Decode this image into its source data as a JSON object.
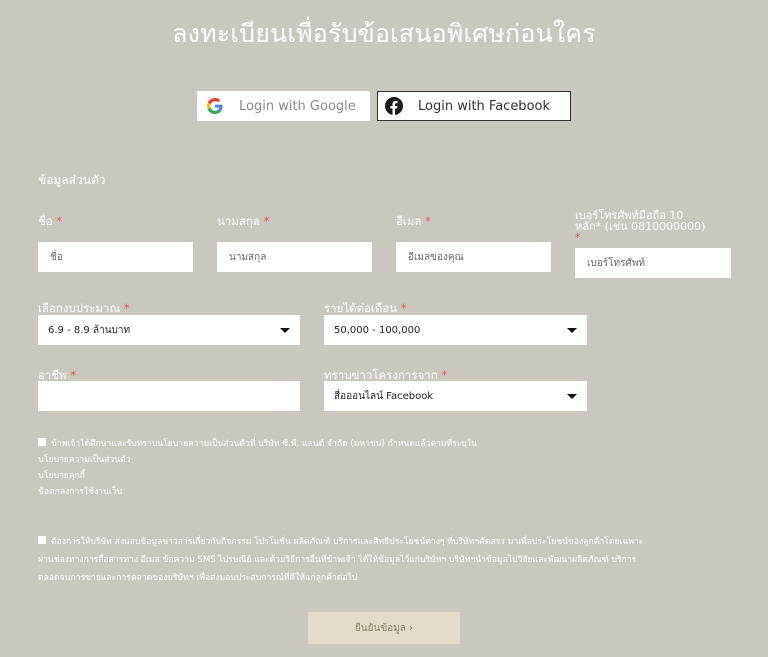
{
  "header": {
    "title": "ลงทะเบียนเพื่อรับข้อเสนอพิเศษก่อนใคร"
  },
  "social": {
    "google_label": "Login with Google",
    "facebook_label": "Login with Facebook"
  },
  "form": {
    "section_title": "ข้อมูลส่วนตัว",
    "required_mark": "*",
    "first_name": {
      "label": "ชื่อ",
      "placeholder": "ชื่อ"
    },
    "last_name": {
      "label": "นามสกุล",
      "placeholder": "นามสกุล"
    },
    "email": {
      "label": "อีเมล",
      "placeholder": "อีเมลของคุณ"
    },
    "phone": {
      "label_line1": "เบอร์โทรศัพท์มือถือ 10",
      "label_line2": "หลัก* (เช่น 0810000000)",
      "placeholder": "เบอร์โทรศัพท์"
    },
    "budget": {
      "label": "เลือกงบประมาณ",
      "value": "6.9 - 8.9 ล้านบาท"
    },
    "income": {
      "label": "รายได้ต่อเดือน",
      "value": "50,000 - 100,000"
    },
    "occupation": {
      "label": "อาชีพ",
      "value": ""
    },
    "source": {
      "label": "ทราบข่าวโครงการจาก",
      "value": "สื่อออนไลน์ Facebook"
    }
  },
  "consent1": {
    "text": "ข้าพเจ้าได้ศึกษาและรับทราบนโยบายความเป็นส่วนตัวที่ บริษัท ซี.พี. แลนด์ จำกัด (มหาชน) กำหนดแล้วตามที่ระบุใน",
    "links": [
      "นโยบายความเป็นส่วนตัว",
      "นโยบายคุกกี้",
      "ข้อตกลงการใช้งานเว็บ"
    ]
  },
  "consent2": {
    "line1": "ต้องการให้บริษัท ส่งมอบข้อมูลข่าวสารเกี่ยวกับกิจกรรม โปรโมชั่น ผลิตภัณฑ์ บริการและสิทธิประโยชน์ต่างๆ ที่บริษัทฯคัดสรร มาเพื่อประโยชน์ของลูกค้าโดยเฉพาะ",
    "line2": "ผ่านช่องทางการสื่อสารทาง อีเมล ข้อความ SMS ไปรษณีย์ และด้วยวิธีการอื่นที่ข้าพเจ้า ได้ให้ข้อมูลไว้แก่บริษัทฯ บริษัทฯนำข้อมูลไปวิจัยและพัฒนาผลิตภัณฑ์ บริการ",
    "line3": "ตลอดจนการขายและการตลาดของบริษัทฯ เพื่อส่งมอบประสบการณ์ที่ดีให้แก่ลูกค้าต่อไป"
  },
  "submit": {
    "label": "ยืนยันข้อมูล ›"
  },
  "colors": {
    "background": "#cac7bf",
    "required": "#e0554f",
    "submit_bg": "#e3dcc9",
    "google_blue": "#4285f4",
    "facebook": "#1a1a1a"
  },
  "icons": {
    "google": "google-icon",
    "facebook": "facebook-icon",
    "caret": "chevron-down-icon",
    "checkbox": "checkbox-icon"
  }
}
